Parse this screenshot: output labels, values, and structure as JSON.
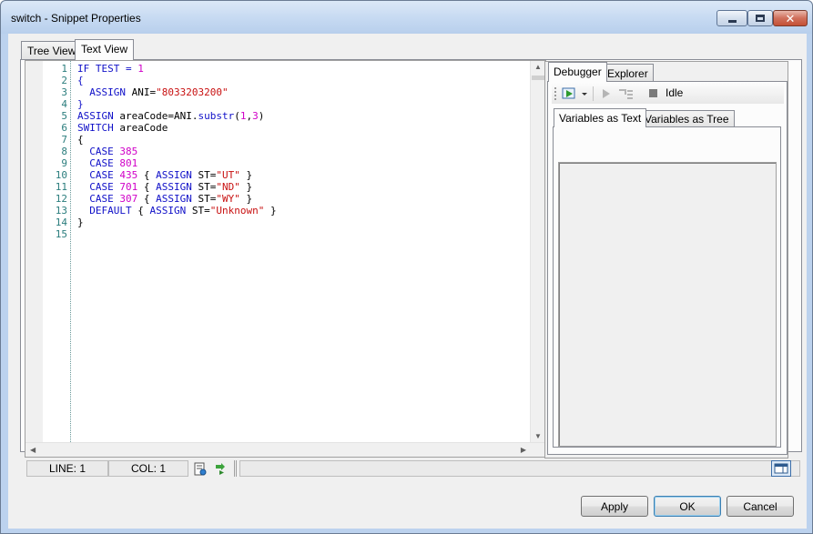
{
  "window": {
    "title": "switch - Snippet Properties"
  },
  "tabs": {
    "tree_view": "Tree View",
    "text_view": "Text View"
  },
  "editor": {
    "line_numbers": [
      "1",
      "2",
      "3",
      "4",
      "5",
      "6",
      "7",
      "8",
      "9",
      "10",
      "11",
      "12",
      "13",
      "14",
      "15"
    ],
    "code_lines": [
      [
        {
          "t": "IF TEST = ",
          "c": "kw"
        },
        {
          "t": "1",
          "c": "num"
        }
      ],
      [
        {
          "t": "{",
          "c": "kw"
        }
      ],
      [
        {
          "t": "  ASSIGN ",
          "c": "kw"
        },
        {
          "t": "ANI=",
          "c": ""
        },
        {
          "t": "\"8033203200\"",
          "c": "str"
        }
      ],
      [
        {
          "t": "}",
          "c": "kw"
        }
      ],
      [
        {
          "t": "ASSIGN ",
          "c": "kw"
        },
        {
          "t": "areaCode=ANI.",
          "c": ""
        },
        {
          "t": "substr",
          "c": "kw"
        },
        {
          "t": "(",
          "c": ""
        },
        {
          "t": "1",
          "c": "num"
        },
        {
          "t": ",",
          "c": ""
        },
        {
          "t": "3",
          "c": "num"
        },
        {
          "t": ")",
          "c": ""
        }
      ],
      [
        {
          "t": "SWITCH ",
          "c": "kw"
        },
        {
          "t": "areaCode",
          "c": ""
        }
      ],
      [
        {
          "t": "{",
          "c": ""
        }
      ],
      [
        {
          "t": "  CASE ",
          "c": "kw"
        },
        {
          "t": "385",
          "c": "num"
        }
      ],
      [
        {
          "t": "  CASE ",
          "c": "kw"
        },
        {
          "t": "801",
          "c": "num"
        }
      ],
      [
        {
          "t": "  CASE ",
          "c": "kw"
        },
        {
          "t": "435",
          "c": "num"
        },
        {
          "t": " { ",
          "c": ""
        },
        {
          "t": "ASSIGN ",
          "c": "kw"
        },
        {
          "t": "ST=",
          "c": ""
        },
        {
          "t": "\"UT\"",
          "c": "str"
        },
        {
          "t": " }",
          "c": ""
        }
      ],
      [
        {
          "t": "  CASE ",
          "c": "kw"
        },
        {
          "t": "701",
          "c": "num"
        },
        {
          "t": " { ",
          "c": ""
        },
        {
          "t": "ASSIGN ",
          "c": "kw"
        },
        {
          "t": "ST=",
          "c": ""
        },
        {
          "t": "\"ND\"",
          "c": "str"
        },
        {
          "t": " }",
          "c": ""
        }
      ],
      [
        {
          "t": "  CASE ",
          "c": "kw"
        },
        {
          "t": "307",
          "c": "num"
        },
        {
          "t": " { ",
          "c": ""
        },
        {
          "t": "ASSIGN ",
          "c": "kw"
        },
        {
          "t": "ST=",
          "c": ""
        },
        {
          "t": "\"WY\"",
          "c": "str"
        },
        {
          "t": " }",
          "c": ""
        }
      ],
      [
        {
          "t": "  DEFAULT ",
          "c": "kw"
        },
        {
          "t": "{ ",
          "c": ""
        },
        {
          "t": "ASSIGN ",
          "c": "kw"
        },
        {
          "t": "ST=",
          "c": ""
        },
        {
          "t": "\"Unknown\"",
          "c": "str"
        },
        {
          "t": " }",
          "c": ""
        }
      ],
      [
        {
          "t": "}",
          "c": ""
        }
      ],
      [
        {
          "t": "",
          "c": ""
        }
      ]
    ]
  },
  "status": {
    "line": "LINE: 1",
    "col": "COL: 1"
  },
  "debugger": {
    "tabs": {
      "debugger": "Debugger",
      "explorer": "Explorer"
    },
    "state": "Idle",
    "var_tabs": {
      "text": "Variables as Text",
      "tree": "Variables as Tree"
    }
  },
  "buttons": {
    "apply": "Apply",
    "ok": "OK",
    "cancel": "Cancel"
  },
  "colors": {
    "keyword": "#1010c8",
    "number": "#d000c8",
    "string": "#c81010",
    "line_number": "#2b7d7d"
  }
}
